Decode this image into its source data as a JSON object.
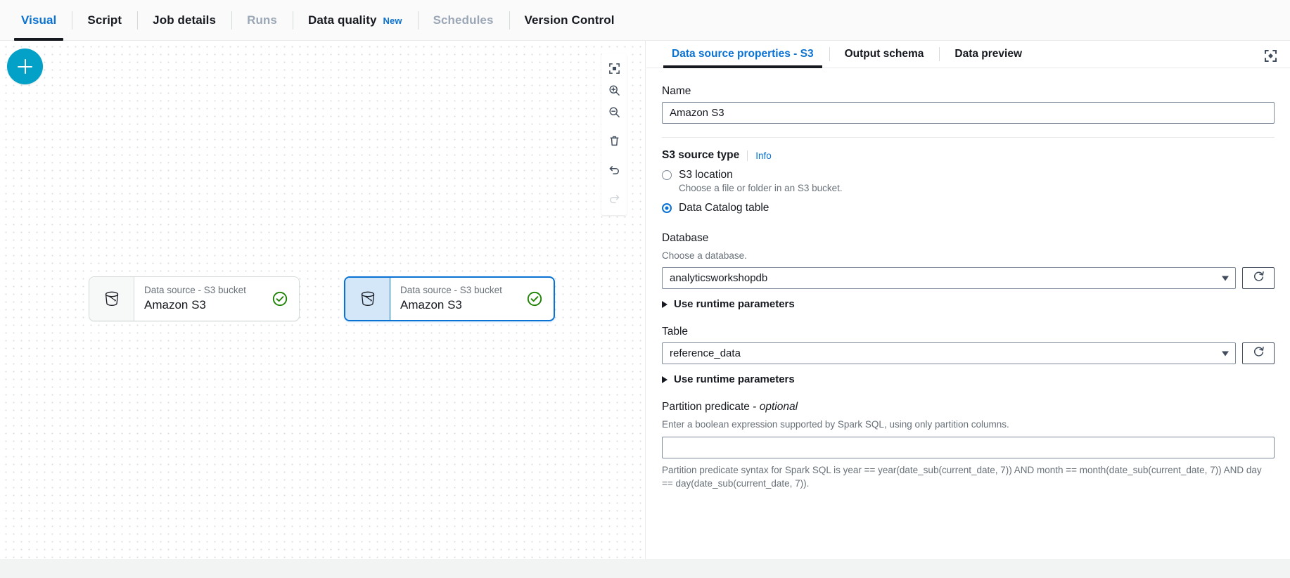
{
  "top_tabs": [
    {
      "label": "Visual",
      "state": "active"
    },
    {
      "label": "Script",
      "state": "normal"
    },
    {
      "label": "Job details",
      "state": "normal"
    },
    {
      "label": "Runs",
      "state": "disabled"
    },
    {
      "label": "Data quality",
      "state": "normal",
      "badge": "New"
    },
    {
      "label": "Schedules",
      "state": "disabled"
    },
    {
      "label": "Version Control",
      "state": "normal"
    }
  ],
  "canvas": {
    "add_button_label": "+",
    "add_button_color": "#03a0c7",
    "nodes": [
      {
        "subtitle": "Data source - S3 bucket",
        "title": "Amazon S3",
        "status": "ok",
        "selected": false
      },
      {
        "subtitle": "Data source - S3 bucket",
        "title": "Amazon S3",
        "status": "ok",
        "selected": true
      }
    ],
    "tools": [
      {
        "name": "fit-to-screen-icon",
        "label": "Fit to screen",
        "disabled": false
      },
      {
        "name": "zoom-in-icon",
        "label": "Zoom in",
        "disabled": false
      },
      {
        "name": "zoom-out-icon",
        "label": "Zoom out",
        "disabled": false
      },
      {
        "name": "delete-icon",
        "label": "Delete",
        "disabled": false
      },
      {
        "name": "undo-icon",
        "label": "Undo",
        "disabled": false
      },
      {
        "name": "redo-icon",
        "label": "Redo",
        "disabled": true
      }
    ]
  },
  "panel": {
    "tabs": [
      {
        "label": "Data source properties - S3",
        "active": true
      },
      {
        "label": "Output schema",
        "active": false
      },
      {
        "label": "Data preview",
        "active": false
      }
    ],
    "expand_icon": "expand-icon",
    "name": {
      "label": "Name",
      "value": "Amazon S3",
      "placeholder": ""
    },
    "s3_source_type": {
      "label": "S3 source type",
      "info_link": "Info",
      "options": [
        {
          "label": "S3 location",
          "description": "Choose a file or folder in an S3 bucket.",
          "selected": false
        },
        {
          "label": "Data Catalog table",
          "description": "",
          "selected": true
        }
      ]
    },
    "database": {
      "label": "Database",
      "hint": "Choose a database.",
      "value": "analyticsworkshopdb",
      "refresh_icon": "refresh-icon",
      "runtime_parameters_label": "Use runtime parameters"
    },
    "table": {
      "label": "Table",
      "value": "reference_data",
      "refresh_icon": "refresh-icon",
      "runtime_parameters_label": "Use runtime parameters"
    },
    "partition_predicate": {
      "label_main": "Partition predicate - ",
      "label_optional": "optional",
      "hint": "Enter a boolean expression supported by Spark SQL, using only partition columns.",
      "value": "",
      "placeholder": "",
      "footnote": "Partition predicate syntax for Spark SQL is year == year(date_sub(current_date, 7)) AND month == month(date_sub(current_date, 7)) AND day == day(date_sub(current_date, 7))."
    }
  },
  "colors": {
    "accent_blue": "#0972d3",
    "teal": "#03a0c7",
    "status_green": "#1d8102",
    "text_dark": "#16191f",
    "text_muted": "#687078"
  }
}
